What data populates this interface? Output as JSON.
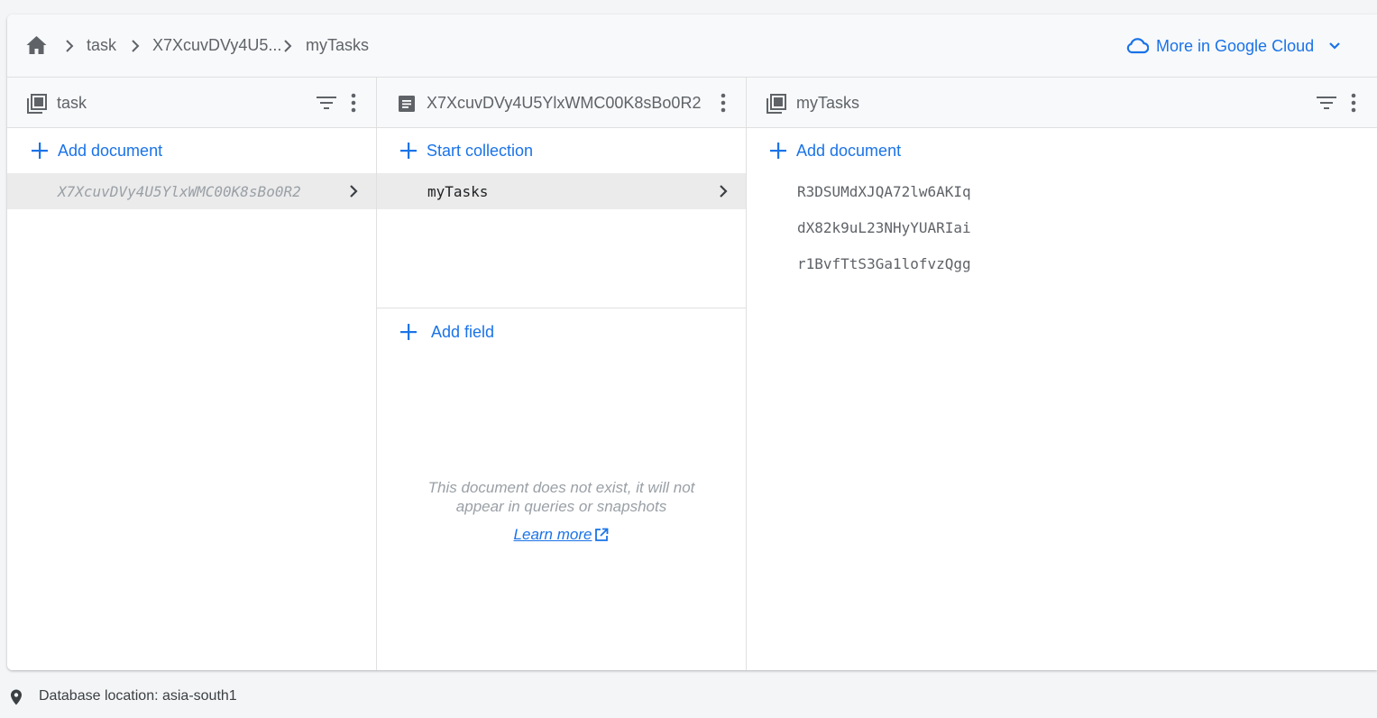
{
  "breadcrumb": {
    "home_icon": "home-icon",
    "items": [
      "task",
      "X7XcuvDVy4U5...",
      "myTasks"
    ]
  },
  "cloud_link": {
    "label": "More in Google Cloud",
    "icon": "cloud-icon"
  },
  "panels": {
    "collection": {
      "title": "task",
      "icon": "collection-icon",
      "add_label": "Add document",
      "documents": [
        "X7XcuvDVy4U5YlxWMC00K8sBo0R2"
      ]
    },
    "document": {
      "title": "X7XcuvDVy4U5YlxWMC00K8sBo0R2",
      "icon": "document-icon",
      "start_collection_label": "Start collection",
      "subcollections": [
        "myTasks"
      ],
      "add_field_label": "Add field",
      "empty_message": "This document does not exist, it will not appear in queries or snapshots",
      "learn_more": "Learn more"
    },
    "subcollection": {
      "title": "myTasks",
      "icon": "collection-icon",
      "add_label": "Add document",
      "documents": [
        "R3DSUMdXJQA72lw6AKIq",
        "dX82k9uL23NHyYUARIai",
        "r1BvfTtS3Ga1lofvzQgg"
      ]
    }
  },
  "footer": {
    "location_text": "Database location: asia-south1"
  },
  "colors": {
    "accent": "#1a73e8",
    "header_bg": "#f8f9fa",
    "selected_bg": "#ebebeb"
  }
}
